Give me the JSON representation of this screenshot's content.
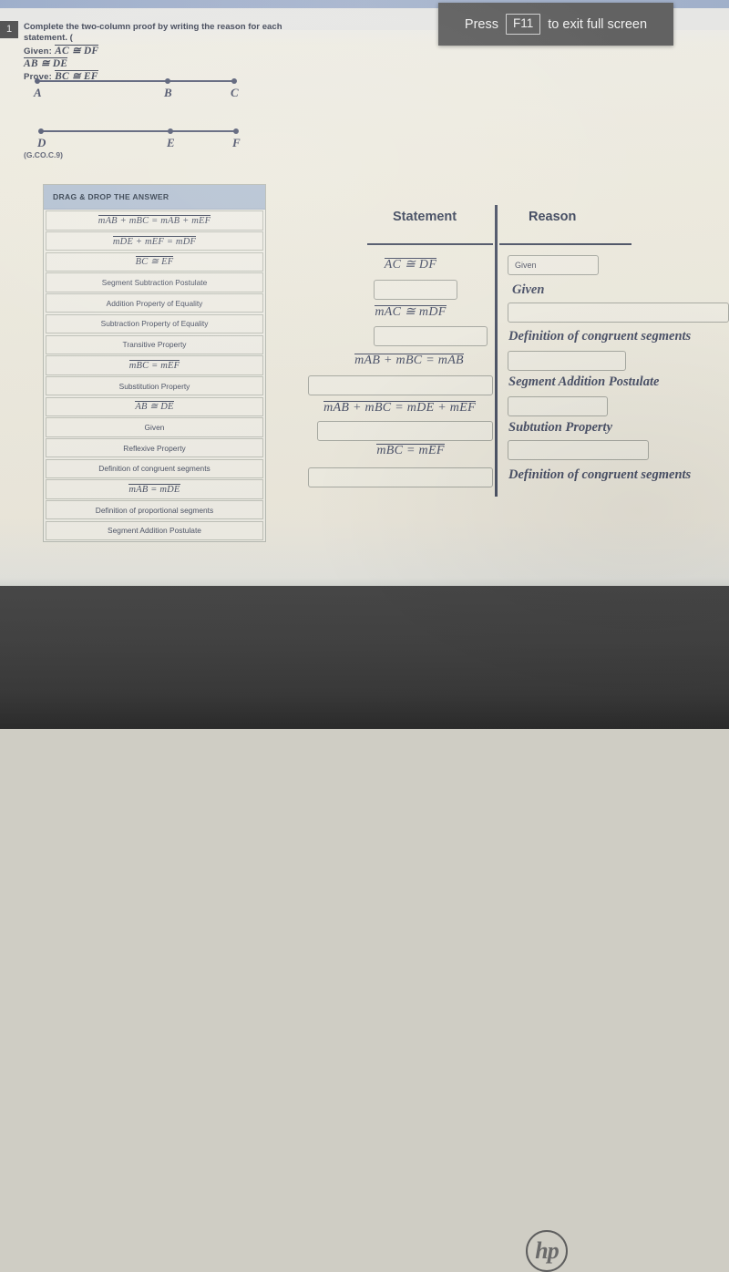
{
  "toast": {
    "before": "Press",
    "key": "F11",
    "after": "to exit full screen"
  },
  "question": {
    "number": "1",
    "instruction": "Complete the two-column proof by writing the reason for each statement. (",
    "given_label": "Given:",
    "given_1": "AC ≅ DF",
    "given_2": "AB ≅ DE",
    "prove_label": "Prove:",
    "prove_1": "BC ≅ EF",
    "standard_code": "(G.CO.C.9)"
  },
  "figures": [
    {
      "name": "segment-abc",
      "points": [
        "A",
        "B",
        "C"
      ]
    },
    {
      "name": "segment-def",
      "points": [
        "D",
        "E",
        "F"
      ]
    }
  ],
  "bank": {
    "header": "DRAG & DROP THE ANSWER",
    "items": [
      {
        "text": "mAB + mBC = mAB + mEF",
        "math": true
      },
      {
        "text": "mDE + mEF = mDF",
        "math": true
      },
      {
        "text": "BC ≅ EF",
        "math": true
      },
      {
        "text": "Segment Subtraction Postulate",
        "math": false
      },
      {
        "text": "Addition Property of Equality",
        "math": false
      },
      {
        "text": "Subtraction Property of Equality",
        "math": false
      },
      {
        "text": "Transitive Property",
        "math": false
      },
      {
        "text": "mBC = mEF",
        "math": true
      },
      {
        "text": "Substitution Property",
        "math": false
      },
      {
        "text": "AB ≅ DE",
        "math": true
      },
      {
        "text": "Given",
        "math": false
      },
      {
        "text": "Reflexive Property",
        "math": false
      },
      {
        "text": "Definition of congruent segments",
        "math": false
      },
      {
        "text": "mAB = mDE",
        "math": true
      },
      {
        "text": "Definition of proportional segments",
        "math": false
      },
      {
        "text": "Segment Addition Postulate",
        "math": false
      }
    ]
  },
  "proof": {
    "headers": {
      "statement": "Statement",
      "reason": "Reason"
    },
    "statements": [
      "AC ≅ DF",
      "mAC ≅ mDF",
      "mAB + mBC = mAB",
      "mAB + mBC = mDE + mEF",
      "mBC = mEF"
    ],
    "statement_blanks": 5,
    "reason_filled_value": "Given",
    "reasons": [
      "Given",
      "Definition of congruent segments",
      "Segment Addition Postulate",
      "Subtution Property",
      "Definition of congruent segments"
    ],
    "reason_blanks": 5
  },
  "device": {
    "brand": "hp"
  },
  "colors": {
    "paper": "#efece0",
    "ink": "#4a5168",
    "bank_header": "#b6c3d4",
    "toast_bg": "#5c5c5c",
    "bezel": "#3a3a3a"
  }
}
